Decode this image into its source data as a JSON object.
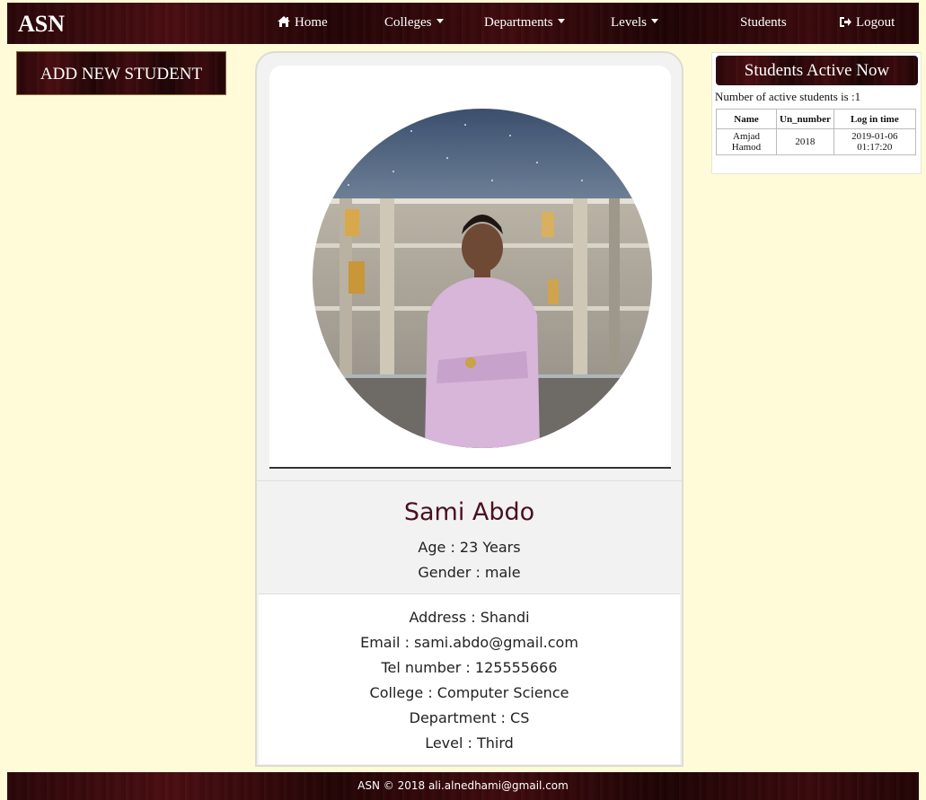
{
  "navbar": {
    "brand": "ASN",
    "items": [
      {
        "label": "Home",
        "icon": "home-icon"
      },
      {
        "label": "Colleges",
        "dropdown": true
      },
      {
        "label": "Departments",
        "dropdown": true
      },
      {
        "label": "Levels",
        "dropdown": true
      },
      {
        "label": "Students"
      },
      {
        "label": "Logout",
        "icon": "logout-icon"
      }
    ]
  },
  "sidebar": {
    "add_button_label": "ADD NEW STUDENT"
  },
  "profile": {
    "name": "Sami Abdo",
    "age": "Age : 23 Years",
    "gender": "Gender : male",
    "details": [
      "Address : Shandi",
      "Email : sami.abdo@gmail.com",
      "Tel number : 125555666",
      "College : Computer Science",
      "Department : CS",
      "Level : Third"
    ]
  },
  "active_students": {
    "title": "Students Active Now",
    "count_text": "Number of active students is :1",
    "columns": [
      "Name",
      "Un_number",
      "Log in time"
    ],
    "rows": [
      {
        "name_line1": "Amjad",
        "name_line2": "Hamod",
        "un_number": "2018",
        "time_line1": "2019-01-06",
        "time_line2": "01:17:20"
      }
    ]
  },
  "footer": {
    "text": "ASN © 2018 ali.alnedhami@gmail.com"
  },
  "colors": {
    "page_background": "#fffbd9",
    "brand_dark": "#2a0608",
    "name_color": "#4a1020"
  }
}
